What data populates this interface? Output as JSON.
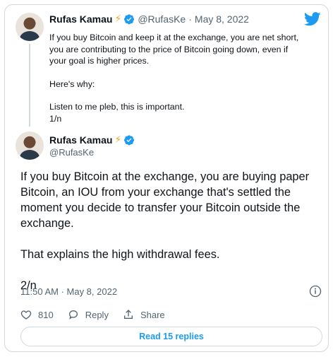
{
  "quoted_tweet": {
    "author_name": "Rufas Kamau",
    "bolt": "⚡",
    "handle": "@RufasKe",
    "separator": "·",
    "date": "May 8, 2022",
    "lines": [
      "If you buy Bitcoin and keep it at the exchange, you are net short, you are contributing to the price of Bitcoin going down, even if your goal is higher prices.",
      "Here's why:",
      "Listen to me pleb, this is important.",
      "1/n"
    ]
  },
  "main_tweet": {
    "author_name": "Rufas Kamau",
    "bolt": "⚡",
    "handle": "@RufasKe",
    "paragraphs": [
      "If you buy Bitcoin at the exchange, you are buying paper Bitcoin, an IOU from your exchange that's settled the moment you decide to transfer your Bitcoin outside the exchange.",
      "That explains the high withdrawal fees.",
      "2/n"
    ],
    "timestamp": "11:50 AM · May 8, 2022"
  },
  "actions": {
    "like_count": "810",
    "reply_label": "Reply",
    "share_label": "Share"
  },
  "read_replies_label": "Read 15 replies",
  "icons": {
    "logo": "twitter-bird-icon",
    "verified": "verified-badge-icon",
    "info": "info-icon",
    "like": "heart-icon",
    "reply": "reply-bubble-icon",
    "share": "share-icon"
  },
  "colors": {
    "twitter_blue": "#1d9bf0",
    "text_primary": "#0f1419",
    "text_secondary": "#536471",
    "border": "#cfd9de",
    "bolt": "#f5a623"
  }
}
